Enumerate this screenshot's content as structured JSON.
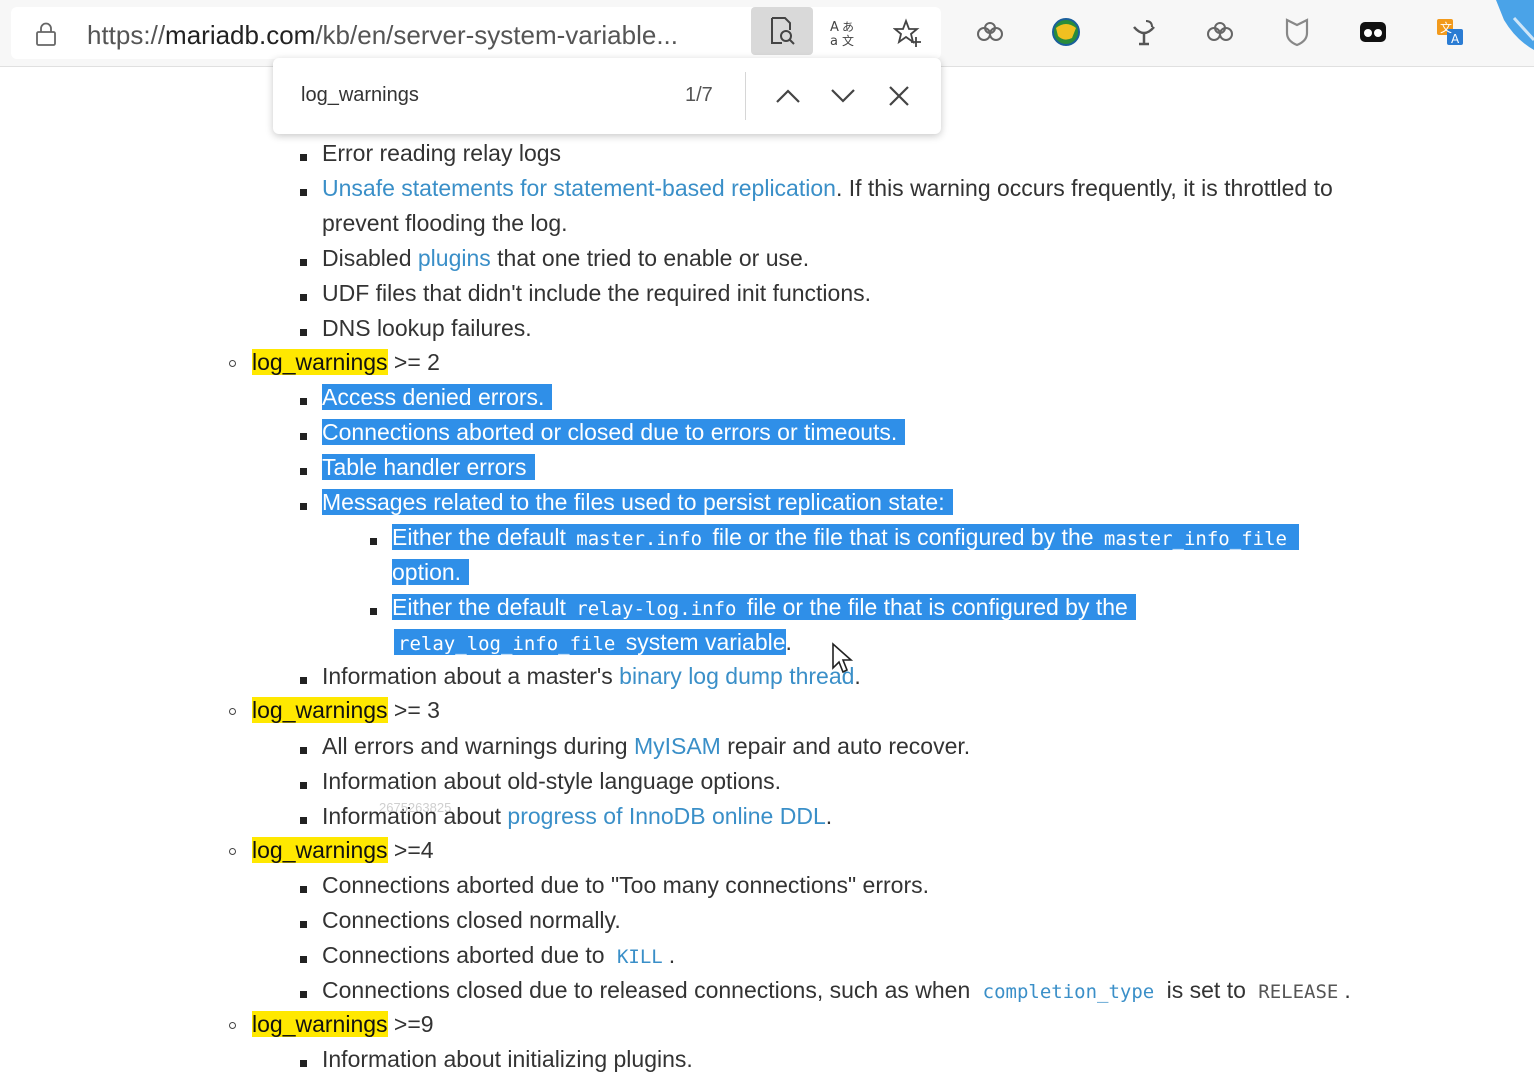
{
  "browser": {
    "url_prefix": "https://",
    "url_host": "mariadb.com",
    "url_rest": "/kb/en/server-system-variable..."
  },
  "find": {
    "query": "log_warnings",
    "count": "1/7"
  },
  "content": {
    "l1": "Error reading relay logs",
    "l2_link": "Unsafe statements for statement-based replication",
    "l2_rest": ". If this warning occurs frequently, it is throttled to",
    "l2b": "prevent flooding the log.",
    "l3_a": "Disabled ",
    "l3_link": "plugins",
    "l3_b": " that one tried to enable or use.",
    "l4": "UDF files that didn't include the required init functions.",
    "l5": "DNS lookup failures.",
    "s2_key": "log_warnings",
    "s2_rest": " >= 2",
    "a1": "Access denied errors.",
    "a2": "Connections aborted or closed due to errors or timeouts.",
    "a3": "Table handler errors",
    "a4": "Messages related to the files used to persist replication state:",
    "b1_a": "Either the default ",
    "b1_code": "master.info",
    "b1_b": " file or the file that is configured by the ",
    "b1_code2": "master_info_file",
    "b1c": "option.",
    "b2_a": "Either the default ",
    "b2_code": "relay-log.info",
    "b2_b": " file or the file that is configured by the",
    "b2c_code": "relay_log_info_file",
    "b2c_b": " system variable",
    "b2c_end": ".",
    "a5_a": "Information about a master's ",
    "a5_link": "binary log dump thread",
    "a5_end": ".",
    "s3_key": "log_warnings",
    "s3_rest": " >= 3",
    "c1_a": "All errors and warnings during ",
    "c1_link": "MyISAM",
    "c1_b": " repair and auto recover.",
    "c2": "Information about old-style language options.",
    "c3_a": "Information about ",
    "c3_link": "progress of InnoDB online DDL",
    "c3_end": ".",
    "watermark": "2675263825",
    "s4_key": "log_warnings",
    "s4_rest": " >=4",
    "d1": "Connections aborted due to \"Too many connections\" errors.",
    "d2": "Connections closed normally.",
    "d3_a": "Connections aborted due to ",
    "d3_code": "KILL",
    "d3_end": ".",
    "d4_a": "Connections closed due to released connections, such as when ",
    "d4_code": "completion_type",
    "d4_b": " is set to ",
    "d4_code2": "RELEASE",
    "d4_end": ".",
    "s9_key": "log_warnings",
    "s9_rest": " >=9",
    "e1": "Information about initializing plugins."
  },
  "colors": {
    "link": "#3a8fc8",
    "highlight": "#ffe800",
    "selection": "#2f8fe8"
  }
}
